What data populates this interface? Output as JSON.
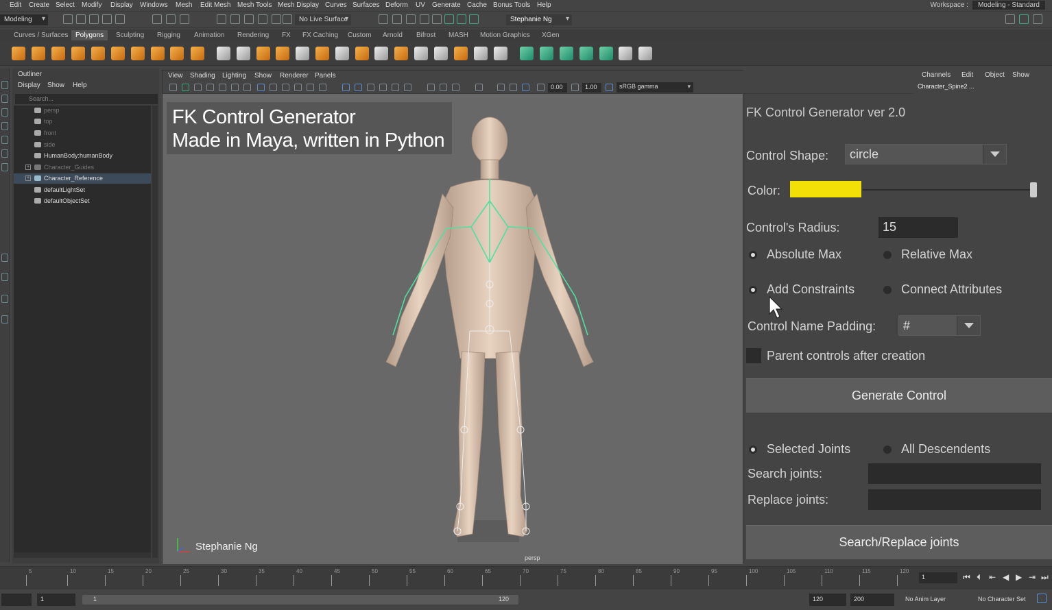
{
  "menubar": {
    "items": [
      "Edit",
      "Create",
      "Select",
      "Modify",
      "Display",
      "Windows",
      "Mesh",
      "Edit Mesh",
      "Mesh Tools",
      "Mesh Display",
      "Curves",
      "Surfaces",
      "Deform",
      "UV",
      "Generate",
      "Cache",
      "Bonus Tools",
      "Help"
    ],
    "workspace_label": "Workspace :",
    "workspace_value": "Modeling - Standard"
  },
  "statusline": {
    "mode": "Modeling",
    "live_surface": "No Live Surface",
    "user": "Stephanie Ng"
  },
  "shelf_tabs": [
    "Curves / Surfaces",
    "Polygons",
    "Sculpting",
    "Rigging",
    "Animation",
    "Rendering",
    "FX",
    "FX Caching",
    "Custom",
    "Arnold",
    "Bifrost",
    "MASH",
    "Motion Graphics",
    "XGen"
  ],
  "shelf_active": "Polygons",
  "outliner": {
    "title": "Outliner",
    "menu": [
      "Display",
      "Show",
      "Help"
    ],
    "search_placeholder": "Search...",
    "items": [
      {
        "label": "persp",
        "dim": true
      },
      {
        "label": "top",
        "dim": true
      },
      {
        "label": "front",
        "dim": true
      },
      {
        "label": "side",
        "dim": true
      },
      {
        "label": "HumanBody:humanBody",
        "dim": false
      },
      {
        "label": "Character_Guides",
        "dim": true
      },
      {
        "label": "Character_Reference",
        "dim": false
      },
      {
        "label": "defaultLightSet",
        "dim": false
      },
      {
        "label": "defaultObjectSet",
        "dim": false
      }
    ]
  },
  "viewport": {
    "menu": [
      "View",
      "Shading",
      "Lighting",
      "Show",
      "Renderer",
      "Panels"
    ],
    "exposure": "0.00",
    "gamma": "1.00",
    "color_space": "sRGB gamma",
    "overlay_line1": "FK Control Generator",
    "overlay_line2": "Made in Maya, written in Python",
    "watermark": "Stephanie Ng",
    "camera": "persp"
  },
  "channels": {
    "menu": [
      "Channels",
      "Edit",
      "Object",
      "Show"
    ],
    "node": "Character_Spine2 ..."
  },
  "fk_panel": {
    "title": "FK Control Generator ver 2.0",
    "control_shape_label": "Control Shape:",
    "control_shape_value": "circle",
    "color_label": "Color:",
    "color_value": "#f2e006",
    "radius_label": "Control's Radius:",
    "radius_value": "15",
    "absolute_max": "Absolute Max",
    "relative_max": "Relative Max",
    "add_constraints": "Add Constraints",
    "connect_attributes": "Connect Attributes",
    "padding_label": "Control Name Padding:",
    "padding_value": "#",
    "parent_label": "Parent controls after creation",
    "generate_button": "Generate Control",
    "selected_joints": "Selected Joints",
    "all_descendents": "All Descendents",
    "search_label": "Search joints:",
    "replace_label": "Replace joints:",
    "search_replace_button": "Search/Replace joints"
  },
  "timeline": {
    "ticks": [
      "5",
      "10",
      "15",
      "20",
      "25",
      "30",
      "35",
      "40",
      "45",
      "50",
      "55",
      "60",
      "65",
      "70",
      "75",
      "80",
      "85",
      "90",
      "95",
      "100",
      "105",
      "110",
      "115",
      "120"
    ],
    "current_frame": "1"
  },
  "rangebar": {
    "start_frame": "1",
    "range_start": "1",
    "range_end": "120",
    "end_frame": "120",
    "total_frames": "200",
    "anim_layer": "No Anim Layer",
    "character_set": "No Character Set"
  }
}
